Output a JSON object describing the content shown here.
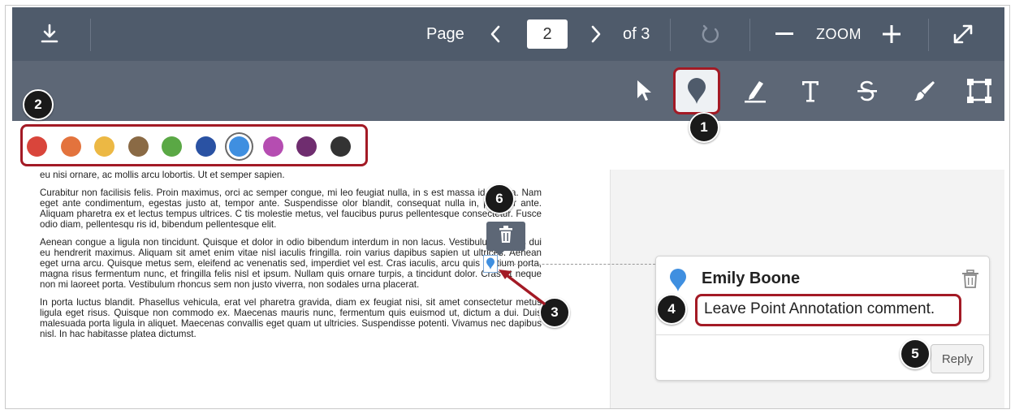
{
  "toolbar": {
    "download_icon": "download-icon",
    "page_label": "Page",
    "page_value": "2",
    "of_label": "of 3",
    "zoom_label": "ZOOM",
    "icons": [
      "chevron-left-icon",
      "chevron-right-icon",
      "rotate-icon",
      "zoom-out-icon",
      "zoom-in-icon",
      "fullscreen-icon"
    ]
  },
  "annotation_tools": {
    "tools": [
      "select-cursor-icon",
      "point-annotation-icon",
      "highlight-icon",
      "text-icon",
      "strikeout-icon",
      "freedraw-icon",
      "area-icon"
    ],
    "active_tool": "point-annotation-icon"
  },
  "palette": {
    "colors": [
      "#d9453b",
      "#e3733d",
      "#ecb844",
      "#8a6a45",
      "#5aa845",
      "#2a52a3",
      "#3f8fe0",
      "#b54db1",
      "#6f2d6f",
      "#333333"
    ],
    "selected_index": 6
  },
  "document": {
    "paragraphs": [
      "eu nisi ornare, ac mollis arcu lobortis. Ut et semper sapien.",
      "Curabitur non facilisis felis. Proin maximus, orci ac semper congue, mi leo feugiat nulla, in s         est massa id massa. Nam eget ante condimentum, egestas justo at, tempor ante. Suspendisse      olor blandit, consequat nulla in, pulvinar ante. Aliquam pharetra ex et lectus tempus ultrices. C         tis molestie metus, vel faucibus purus pellentesque consectetur. Fusce odio diam, pellentesqu      ris id, bibendum pellentesque elit.",
      "Aenean congue a ligula non tincidunt. Quisque et dolor in odio bibendum interdum in non lacus. Vestibulum cursus dui eu hendrerit maximus. Aliquam sit amet enim vitae nisl iaculis fringilla.    roin varius dapibus sapien ut ultrices. Aenean eget urna arcu. Quisque metus sem, eleifend ac venenatis sed, imperdiet vel est. Cras iaculis, arcu quis pretium porta, magna risus fermentum nunc, et fringilla felis nisl et ipsum. Nullam quis ornare turpis, a tincidunt dolor. Cras ut neque non mi laoreet porta. Vestibulum rhoncus sem non justo viverra, non sodales urna placerat.",
      "In porta luctus blandit. Phasellus vehicula, erat vel pharetra gravida, diam ex feugiat nisi, sit amet consectetur metus ligula eget risus. Quisque non commodo ex. Maecenas mauris nunc, fermentum quis euismod ut, dictum a dui. Duis malesuada porta ligula in aliquet. Maecenas convallis eget quam ut ultricies. Suspendisse potenti. Vivamus nec dapibus nisl. In hac habitasse platea dictumst."
    ]
  },
  "comment": {
    "author": "Emily Boone",
    "text": "Leave Point Annotation comment.",
    "reply_label": "Reply"
  },
  "callouts": [
    "1",
    "2",
    "3",
    "4",
    "5",
    "6"
  ],
  "colors": {
    "toolbar_dark": "#4f5b6b",
    "toolbar_light": "#5d6776",
    "highlight_red": "#a31a25",
    "pin_blue": "#3f8fe0"
  }
}
